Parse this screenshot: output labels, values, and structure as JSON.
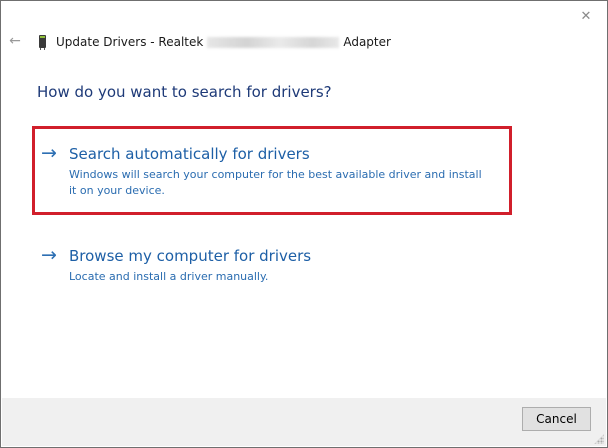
{
  "window": {
    "close_glyph": "✕",
    "back_glyph": "←"
  },
  "header": {
    "title_prefix": "Update Drivers - Realtek",
    "title_suffix": "Adapter",
    "device_icon": "network-adapter-icon"
  },
  "main": {
    "heading": "How do you want to search for drivers?",
    "options": [
      {
        "label": "Search automatically for drivers",
        "description": "Windows will search your computer for the best available driver and install it on your device.",
        "arrow_glyph": "→"
      },
      {
        "label": "Browse my computer for drivers",
        "description": "Locate and install a driver manually.",
        "arrow_glyph": "→"
      }
    ]
  },
  "footer": {
    "cancel_label": "Cancel"
  },
  "colors": {
    "heading": "#1e3a78",
    "link": "#1d5fa6",
    "highlight": "#d11f2b",
    "footer_bg": "#f0f0f0"
  }
}
